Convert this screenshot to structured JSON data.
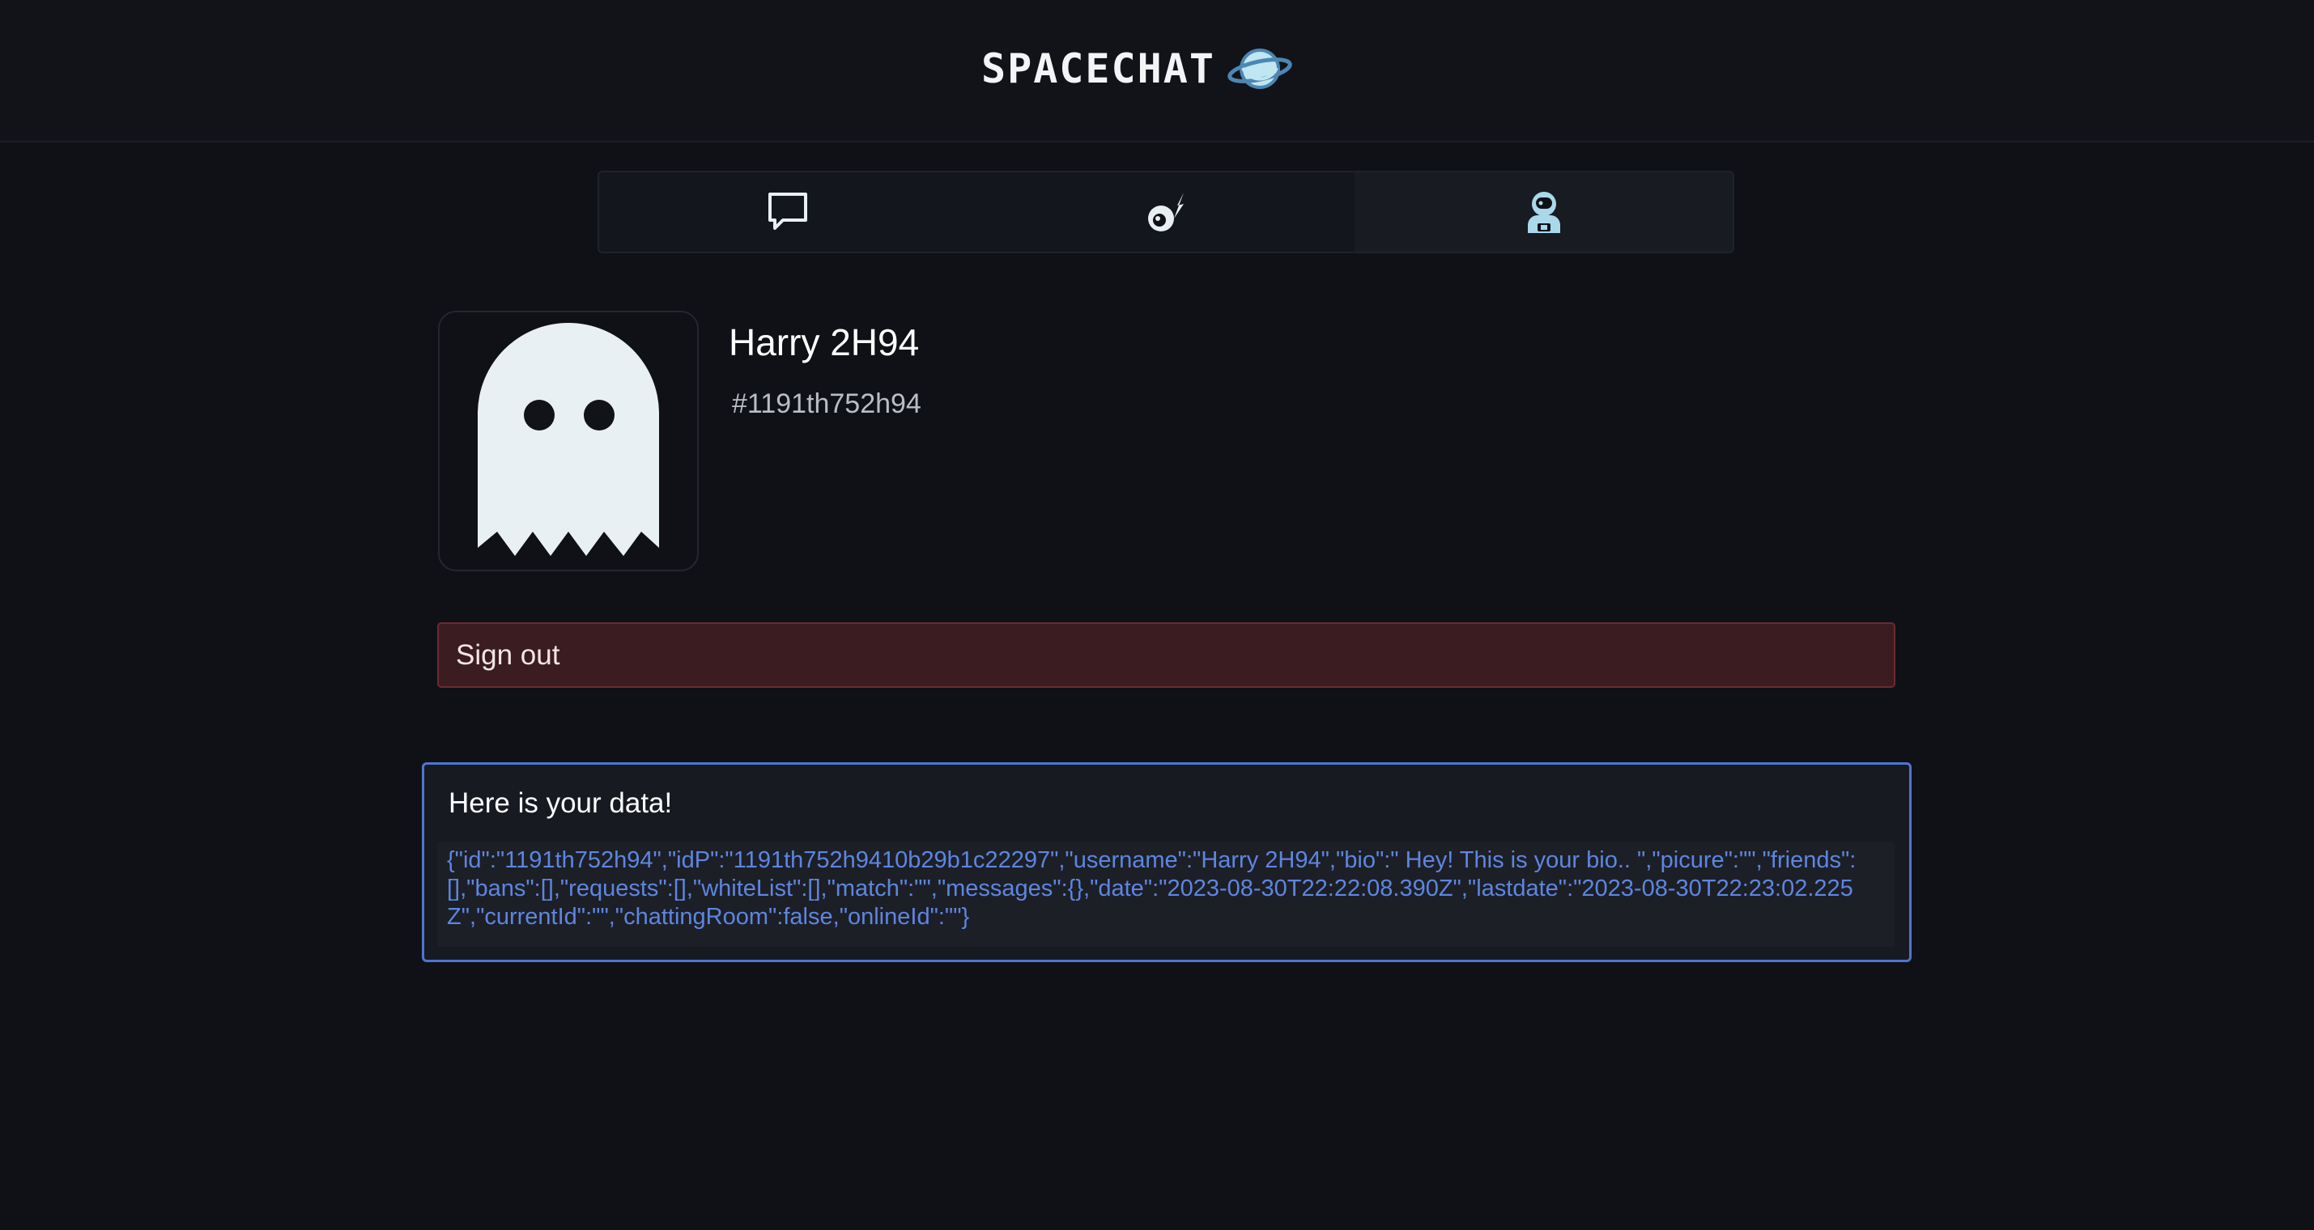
{
  "header": {
    "brand": "SPACECHAT",
    "planet_icon": "planet-icon"
  },
  "tabs": [
    {
      "name": "chat",
      "icon": "chat-bubble-icon",
      "active": false
    },
    {
      "name": "discover",
      "icon": "comet-icon",
      "active": false
    },
    {
      "name": "profile",
      "icon": "astronaut-icon",
      "active": true
    }
  ],
  "profile": {
    "avatar_icon": "ghost-icon",
    "username": "Harry 2H94",
    "user_id": "#1191th752h94"
  },
  "actions": {
    "sign_out_label": "Sign out"
  },
  "data_panel": {
    "title": "Here is your data!",
    "json_text": "{\"id\":\"1191th752h94\",\"idP\":\"1191th752h9410b29b1c22297\",\"username\":\"Harry 2H94\",\"bio\":\" Hey! This is your bio.. \",\"picure\":\"\",\"friends\":[],\"bans\":[],\"requests\":[],\"whiteList\":[],\"match\":\"\",\"messages\":{},\"date\":\"2023-08-30T22:22:08.390Z\",\"lastdate\":\"2023-08-30T22:23:02.225Z\",\"currentId\":\"\",\"chattingRoom\":false,\"onlineId\":\"\"}"
  },
  "colors": {
    "background": "#0f1116",
    "accent_blue": "#4f74d1",
    "danger_bg": "#3b1d21",
    "danger_border": "#6a2b31"
  }
}
